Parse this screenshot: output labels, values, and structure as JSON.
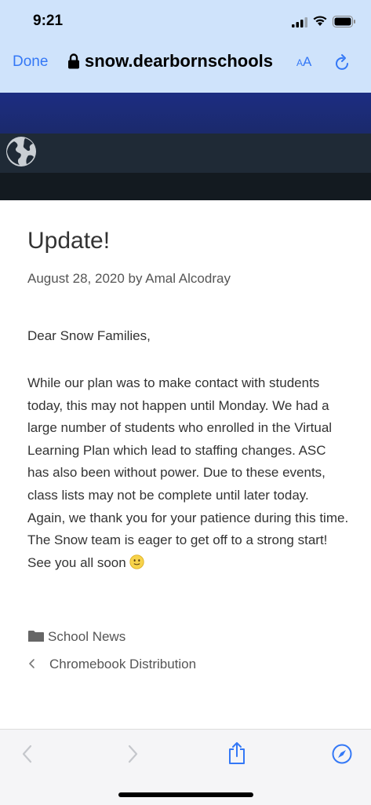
{
  "status": {
    "time": "9:21"
  },
  "browser": {
    "done_label": "Done",
    "url": "snow.dearbornschools",
    "text_size_label_small": "A",
    "text_size_label_large": "A"
  },
  "article": {
    "title": "Update!",
    "meta": "August 28, 2020 by Amal Alcodray",
    "greeting": "Dear Snow Families,",
    "body": "While our plan was to make contact with students today, this may not happen until Monday. We had a large number of students who enrolled in the Virtual Learning Plan which lead to staffing changes. ASC has also been without power. Due to these events, class lists may not be complete until later today. Again, we thank you for your patience during this time. The Snow team is eager to get off to a strong start! See you all soon",
    "category": "School News",
    "previous_post": "Chromebook Distribution"
  },
  "colors": {
    "accent": "#3478f6",
    "browser_bar": "#cfe3fb",
    "banner_blue": "#1c2d82",
    "banner_dark": "#1f2a36"
  },
  "icons": [
    "lock-icon",
    "reload-icon",
    "globe-icon",
    "emoji-icon",
    "folder-icon",
    "chevron-left-icon",
    "back-icon",
    "forward-icon",
    "share-icon",
    "compass-icon"
  ]
}
